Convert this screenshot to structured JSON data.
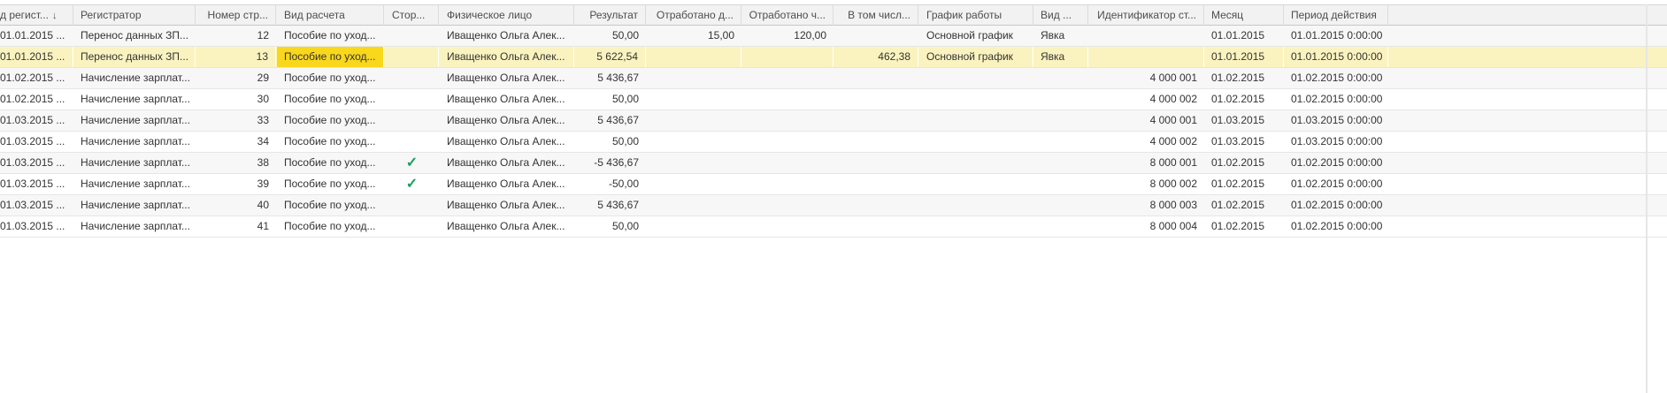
{
  "columns": [
    {
      "key": "date",
      "label": "д регист..."
    },
    {
      "key": "registrar",
      "label": "Регистратор"
    },
    {
      "key": "line",
      "label": "Номер стр..."
    },
    {
      "key": "calc",
      "label": "Вид расчета"
    },
    {
      "key": "storno",
      "label": "Стор..."
    },
    {
      "key": "person",
      "label": "Физическое лицо"
    },
    {
      "key": "result",
      "label": "Результат"
    },
    {
      "key": "days",
      "label": "Отработано д..."
    },
    {
      "key": "hours",
      "label": "Отработано ч..."
    },
    {
      "key": "incl",
      "label": "В том числ..."
    },
    {
      "key": "schedule",
      "label": "График работы"
    },
    {
      "key": "kind",
      "label": "Вид ..."
    },
    {
      "key": "ident",
      "label": "Идентификатор ст..."
    },
    {
      "key": "month",
      "label": "Месяц"
    },
    {
      "key": "period",
      "label": "Период действия"
    }
  ],
  "sort_indicator": "↓",
  "check_icon": "✓",
  "rows": [
    {
      "date": "01.01.2015 ...",
      "registrar": "Перенос данных ЗП...",
      "line": "12",
      "calc": "Пособие по уход...",
      "storno": false,
      "person": "Иващенко Ольга Алек...",
      "result": "50,00",
      "days": "15,00",
      "hours": "120,00",
      "incl": "",
      "schedule": "Основной график",
      "kind": "Явка",
      "ident": "",
      "month": "01.01.2015",
      "period": "01.01.2015 0:00:00"
    },
    {
      "date": "01.01.2015 ...",
      "registrar": "Перенос данных ЗП...",
      "line": "13",
      "calc": "Пособие по уход...",
      "storno": false,
      "person": "Иващенко Ольга Алек...",
      "result": "5 622,54",
      "days": "",
      "hours": "",
      "incl": "462,38",
      "schedule": "Основной график",
      "kind": "Явка",
      "ident": "",
      "month": "01.01.2015",
      "period": "01.01.2015 0:00:00",
      "selected": true
    },
    {
      "date": "01.02.2015 ...",
      "registrar": "Начисление зарплат...",
      "line": "29",
      "calc": "Пособие по уход...",
      "storno": false,
      "person": "Иващенко Ольга Алек...",
      "result": "5 436,67",
      "days": "",
      "hours": "",
      "incl": "",
      "schedule": "",
      "kind": "",
      "ident": "4 000 001",
      "month": "01.02.2015",
      "period": "01.02.2015 0:00:00"
    },
    {
      "date": "01.02.2015 ...",
      "registrar": "Начисление зарплат...",
      "line": "30",
      "calc": "Пособие по уход...",
      "storno": false,
      "person": "Иващенко Ольга Алек...",
      "result": "50,00",
      "days": "",
      "hours": "",
      "incl": "",
      "schedule": "",
      "kind": "",
      "ident": "4 000 002",
      "month": "01.02.2015",
      "period": "01.02.2015 0:00:00"
    },
    {
      "date": "01.03.2015 ...",
      "registrar": "Начисление зарплат...",
      "line": "33",
      "calc": "Пособие по уход...",
      "storno": false,
      "person": "Иващенко Ольга Алек...",
      "result": "5 436,67",
      "days": "",
      "hours": "",
      "incl": "",
      "schedule": "",
      "kind": "",
      "ident": "4 000 001",
      "month": "01.03.2015",
      "period": "01.03.2015 0:00:00"
    },
    {
      "date": "01.03.2015 ...",
      "registrar": "Начисление зарплат...",
      "line": "34",
      "calc": "Пособие по уход...",
      "storno": false,
      "person": "Иващенко Ольга Алек...",
      "result": "50,00",
      "days": "",
      "hours": "",
      "incl": "",
      "schedule": "",
      "kind": "",
      "ident": "4 000 002",
      "month": "01.03.2015",
      "period": "01.03.2015 0:00:00"
    },
    {
      "date": "01.03.2015 ...",
      "registrar": "Начисление зарплат...",
      "line": "38",
      "calc": "Пособие по уход...",
      "storno": true,
      "person": "Иващенко Ольга Алек...",
      "result": "-5 436,67",
      "days": "",
      "hours": "",
      "incl": "",
      "schedule": "",
      "kind": "",
      "ident": "8 000 001",
      "month": "01.02.2015",
      "period": "01.02.2015 0:00:00"
    },
    {
      "date": "01.03.2015 ...",
      "registrar": "Начисление зарплат...",
      "line": "39",
      "calc": "Пособие по уход...",
      "storno": true,
      "person": "Иващенко Ольга Алек...",
      "result": "-50,00",
      "days": "",
      "hours": "",
      "incl": "",
      "schedule": "",
      "kind": "",
      "ident": "8 000 002",
      "month": "01.02.2015",
      "period": "01.02.2015 0:00:00"
    },
    {
      "date": "01.03.2015 ...",
      "registrar": "Начисление зарплат...",
      "line": "40",
      "calc": "Пособие по уход...",
      "storno": false,
      "person": "Иващенко Ольга Алек...",
      "result": "5 436,67",
      "days": "",
      "hours": "",
      "incl": "",
      "schedule": "",
      "kind": "",
      "ident": "8 000 003",
      "month": "01.02.2015",
      "period": "01.02.2015 0:00:00"
    },
    {
      "date": "01.03.2015 ...",
      "registrar": "Начисление зарплат...",
      "line": "41",
      "calc": "Пособие по уход...",
      "storno": false,
      "person": "Иващенко Ольга Алек...",
      "result": "50,00",
      "days": "",
      "hours": "",
      "incl": "",
      "schedule": "",
      "kind": "",
      "ident": "8 000 004",
      "month": "01.02.2015",
      "period": "01.02.2015 0:00:00"
    }
  ],
  "colors": {
    "selected_row": "#fbf3bf",
    "focused_cell": "#f9d71c",
    "check": "#1ba05a",
    "header_bg": "#f2f2f2"
  }
}
